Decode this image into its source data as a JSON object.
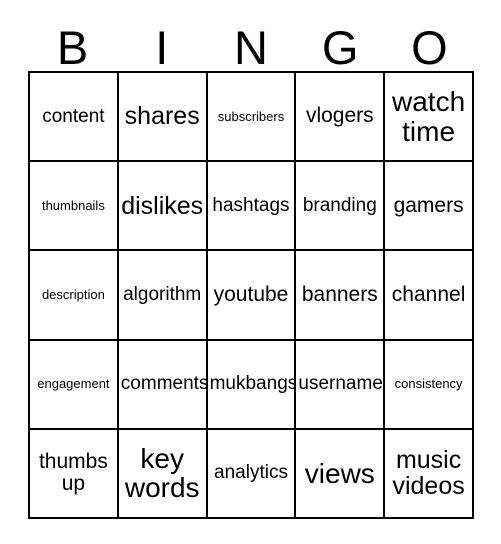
{
  "card": {
    "title_letters": [
      "B",
      "I",
      "N",
      "G",
      "O"
    ],
    "columns": [
      "B",
      "I",
      "N",
      "G",
      "O"
    ],
    "rows": [
      [
        {
          "text": "content",
          "size": "md"
        },
        {
          "text": "shares",
          "size": "xl"
        },
        {
          "text": "subscribers",
          "size": "xs"
        },
        {
          "text": "vlogers",
          "size": "lg"
        },
        {
          "text": "watch time",
          "size": "xxl"
        }
      ],
      [
        {
          "text": "thumbnails",
          "size": "xs"
        },
        {
          "text": "dislikes",
          "size": "xl"
        },
        {
          "text": "hashtags",
          "size": "md"
        },
        {
          "text": "branding",
          "size": "md"
        },
        {
          "text": "gamers",
          "size": "lg"
        }
      ],
      [
        {
          "text": "description",
          "size": "xs"
        },
        {
          "text": "algorithm",
          "size": "md"
        },
        {
          "text": "youtube",
          "size": "lg"
        },
        {
          "text": "banners",
          "size": "lg"
        },
        {
          "text": "channel",
          "size": "lg"
        }
      ],
      [
        {
          "text": "engagement",
          "size": "xs"
        },
        {
          "text": "comments",
          "size": "md"
        },
        {
          "text": "mukbangs",
          "size": "md"
        },
        {
          "text": "username",
          "size": "md"
        },
        {
          "text": "consistency",
          "size": "xs"
        }
      ],
      [
        {
          "text": "thumbs up",
          "size": "lg"
        },
        {
          "text": "key words",
          "size": "xxl"
        },
        {
          "text": "analytics",
          "size": "md"
        },
        {
          "text": "views",
          "size": "xxl"
        },
        {
          "text": "music videos",
          "size": "xl"
        }
      ]
    ]
  },
  "colors": {
    "background": "#ffffff",
    "text": "#000000",
    "border": "#000000"
  }
}
